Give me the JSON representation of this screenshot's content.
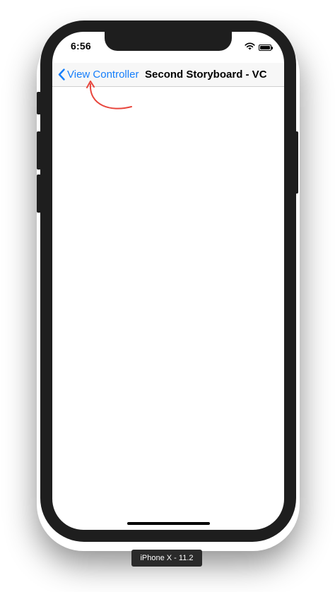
{
  "status_bar": {
    "time": "6:56",
    "icons": [
      "wifi-icon",
      "battery-icon"
    ]
  },
  "navbar": {
    "back_label": "View Controller",
    "back_icon": "chevron-left-icon",
    "title": "Second Storyboard - VC"
  },
  "device": {
    "label": "iPhone X - 11.2"
  },
  "colors": {
    "accent": "#157efb",
    "annotation": "#e8453c",
    "bezel": "#1e1e1e"
  }
}
